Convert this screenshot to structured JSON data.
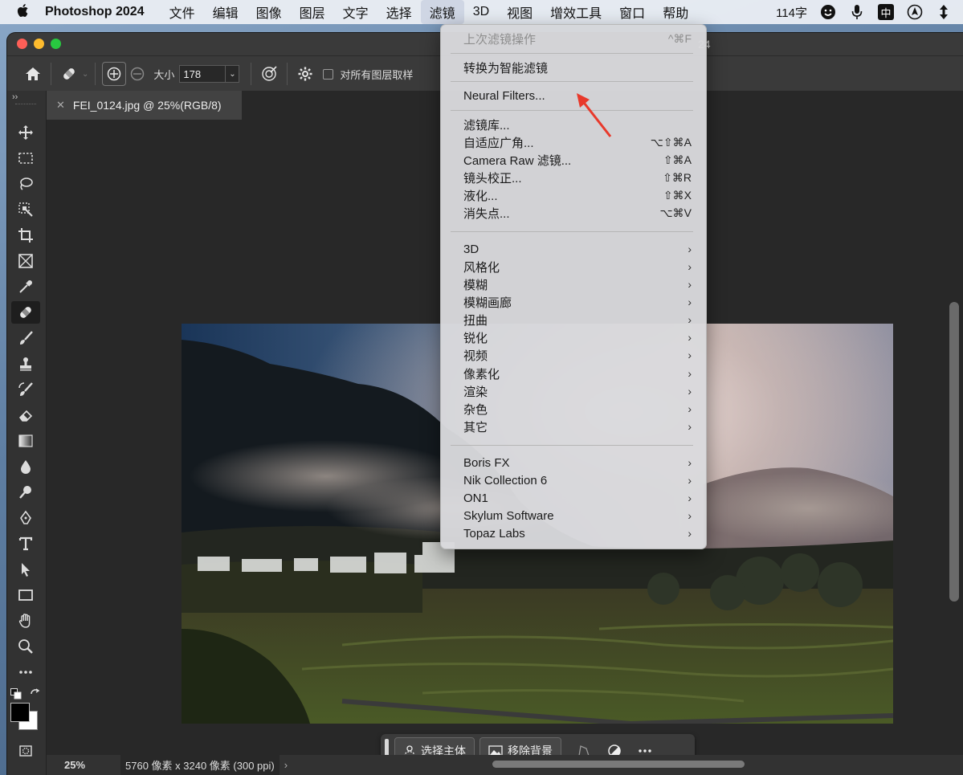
{
  "menubar": {
    "app_name": "Photoshop 2024",
    "items": [
      "文件",
      "编辑",
      "图像",
      "图层",
      "文字",
      "选择",
      "滤镜",
      "3D",
      "视图",
      "增效工具",
      "窗口",
      "帮助"
    ],
    "active_item": "滤镜",
    "word_count": "114字",
    "input_method": "中"
  },
  "window": {
    "title_fragment": "24",
    "document_tab": "FEI_0124.jpg @ 25%(RGB/8)"
  },
  "options_bar": {
    "size_label": "大小",
    "size_value": "178",
    "sample_all_layers_label": "对所有图层取样"
  },
  "filter_menu": {
    "last_filter": {
      "label": "上次滤镜操作",
      "shortcut": "^⌘F"
    },
    "convert_smart": "转换为智能滤镜",
    "neural_filters": "Neural Filters...",
    "group1": [
      {
        "label": "滤镜库...",
        "shortcut": ""
      },
      {
        "label": "自适应广角...",
        "shortcut": "⌥⇧⌘A"
      },
      {
        "label": "Camera Raw 滤镜...",
        "shortcut": "⇧⌘A"
      },
      {
        "label": "镜头校正...",
        "shortcut": "⇧⌘R"
      },
      {
        "label": "液化...",
        "shortcut": "⇧⌘X"
      },
      {
        "label": "消失点...",
        "shortcut": "⌥⌘V"
      }
    ],
    "submenus": [
      "3D",
      "风格化",
      "模糊",
      "模糊画廊",
      "扭曲",
      "锐化",
      "视频",
      "像素化",
      "渲染",
      "杂色",
      "其它"
    ],
    "plugins": [
      "Boris FX",
      "Nik Collection 6",
      "ON1",
      "Skylum Software",
      "Topaz Labs"
    ]
  },
  "taskbar": {
    "select_subject": "选择主体",
    "remove_background": "移除背景"
  },
  "statusbar": {
    "zoom": "25%",
    "doc_info": "5760 像素 x 3240 像素 (300 ppi)"
  },
  "colors": {
    "annotation_arrow": "#e8392b",
    "ps_panel": "#323232",
    "menu_bg": "#dadadd"
  }
}
